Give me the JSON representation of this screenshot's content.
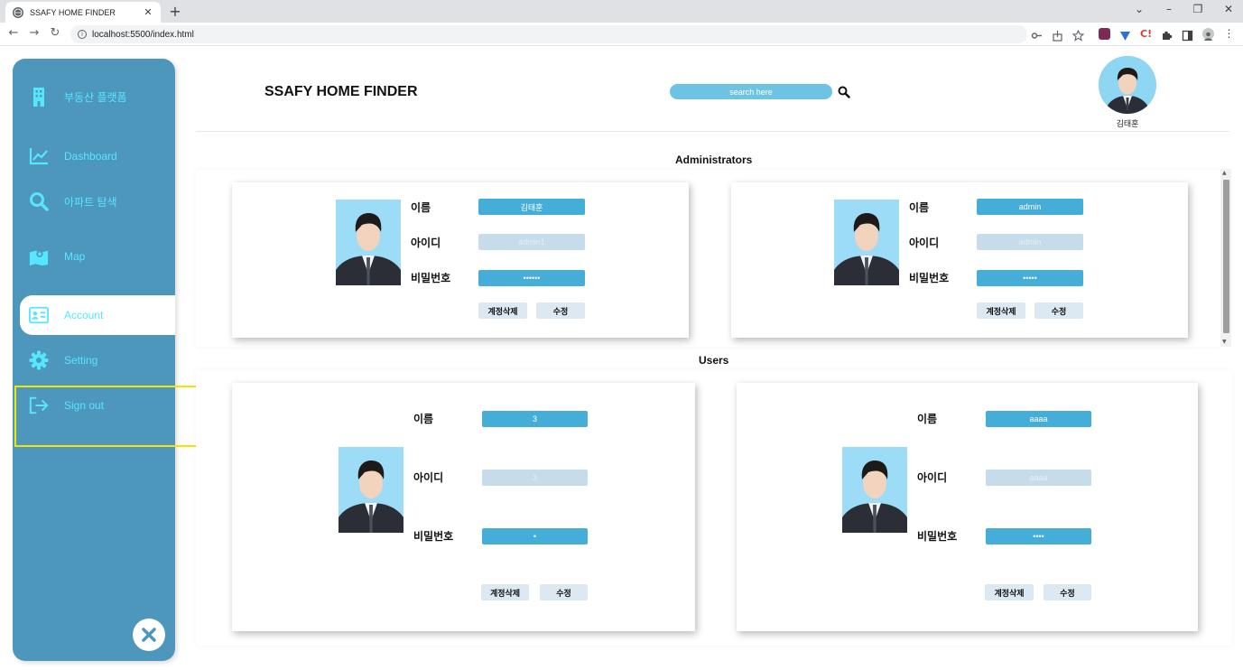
{
  "browser": {
    "tab_title": "SSAFY HOME FINDER",
    "url": "localhost:5500/index.html"
  },
  "sidebar": {
    "items": [
      {
        "label": "부동산 플랫폼",
        "icon": "building-icon"
      },
      {
        "label": "Dashboard",
        "icon": "chart-line-icon"
      },
      {
        "label": "아파트 탐색",
        "icon": "search-icon"
      },
      {
        "label": "Map",
        "icon": "map-icon"
      },
      {
        "label": "Account",
        "icon": "id-card-icon",
        "active": true
      },
      {
        "label": "Setting",
        "icon": "gear-icon"
      },
      {
        "label": "Sign out",
        "icon": "sign-out-icon"
      }
    ]
  },
  "header": {
    "brand": "SSAFY HOME FINDER",
    "search_placeholder": "search here",
    "user_name": "김태훈"
  },
  "sections": {
    "admins_title": "Administrators",
    "users_title": "Users"
  },
  "labels": {
    "name": "이름",
    "id": "아이디",
    "password": "비밀번호",
    "delete": "계정삭제",
    "edit": "수정"
  },
  "admins": [
    {
      "name": "김태훈",
      "id": "admin1",
      "password": "••••••"
    },
    {
      "name": "admin",
      "id": "admin",
      "password": "•••••"
    }
  ],
  "users": [
    {
      "name": "3",
      "id": "3",
      "password": "•"
    },
    {
      "name": "aaaa",
      "id": "aaaa",
      "password": "••••"
    }
  ],
  "colors": {
    "sidebar": "#4e97bc",
    "accent_text": "#57e6ff",
    "field_blue": "#45aed8",
    "field_light": "#c7dcea",
    "highlight": "#f5e400"
  }
}
